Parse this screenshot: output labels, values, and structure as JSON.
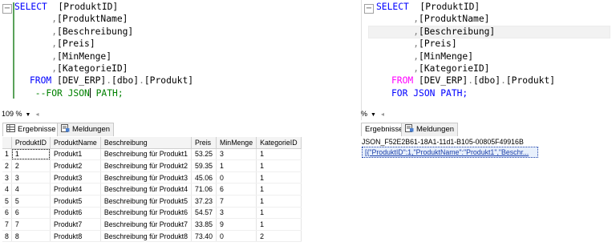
{
  "left_editor": {
    "lines": [
      {
        "parts": [
          {
            "t": "SELECT  ",
            "c": "kw"
          },
          {
            "t": "[ProduktID]",
            "c": "tx"
          }
        ],
        "collapse": "⊟"
      },
      {
        "parts": [
          {
            "t": "      ,",
            "c": "gr"
          },
          {
            "t": "[ProduktName]",
            "c": "tx"
          }
        ]
      },
      {
        "parts": [
          {
            "t": "      ,",
            "c": "gr"
          },
          {
            "t": "[Beschreibung]",
            "c": "tx"
          }
        ]
      },
      {
        "parts": [
          {
            "t": "      ,",
            "c": "gr"
          },
          {
            "t": "[Preis]",
            "c": "tx"
          }
        ]
      },
      {
        "parts": [
          {
            "t": "      ,",
            "c": "gr"
          },
          {
            "t": "[MinMenge]",
            "c": "tx"
          }
        ]
      },
      {
        "parts": [
          {
            "t": "      ,",
            "c": "gr"
          },
          {
            "t": "[KategorieID]",
            "c": "tx"
          }
        ]
      },
      {
        "parts": [
          {
            "t": "  FROM ",
            "c": "kw"
          },
          {
            "t": "[DEV_ERP]",
            "c": "tx"
          },
          {
            "t": ".",
            "c": "gr"
          },
          {
            "t": "[dbo]",
            "c": "tx"
          },
          {
            "t": ".",
            "c": "gr"
          },
          {
            "t": "[Produkt]",
            "c": "tx"
          }
        ]
      },
      {
        "parts": [
          {
            "t": "   --FOR JSON",
            "c": "cm"
          },
          {
            "t": "|",
            "c": "cursor"
          },
          {
            "t": " PATH;",
            "c": "cm"
          }
        ]
      }
    ],
    "zoom": "109 %"
  },
  "right_editor": {
    "lines": [
      {
        "parts": [
          {
            "t": "SELECT  ",
            "c": "kw"
          },
          {
            "t": "[ProduktID]",
            "c": "tx"
          }
        ],
        "collapse": "⊟"
      },
      {
        "parts": [
          {
            "t": "      ,",
            "c": "gr"
          },
          {
            "t": "[ProduktName]",
            "c": "tx"
          }
        ]
      },
      {
        "parts": [
          {
            "t": "      ,",
            "c": "gr"
          },
          {
            "t": "[Beschreibung]",
            "c": "tx"
          }
        ]
      },
      {
        "parts": [
          {
            "t": "      ,",
            "c": "gr"
          },
          {
            "t": "[Preis]",
            "c": "tx"
          }
        ]
      },
      {
        "parts": [
          {
            "t": "      ,",
            "c": "gr"
          },
          {
            "t": "[MinMenge]",
            "c": "tx"
          }
        ]
      },
      {
        "parts": [
          {
            "t": "      ,",
            "c": "gr"
          },
          {
            "t": "[KategorieID]",
            "c": "tx"
          }
        ]
      },
      {
        "parts": [
          {
            "t": "  FROM ",
            "c": "pk"
          },
          {
            "t": "[DEV_ERP]",
            "c": "tx"
          },
          {
            "t": ".",
            "c": "gr"
          },
          {
            "t": "[dbo]",
            "c": "tx"
          },
          {
            "t": ".",
            "c": "gr"
          },
          {
            "t": "[Produkt]",
            "c": "tx"
          }
        ]
      },
      {
        "parts": [
          {
            "t": "  FOR JSON PATH;",
            "c": "kw"
          }
        ]
      }
    ],
    "zoom": "%"
  },
  "left_tabs": {
    "results": "Ergebnisse",
    "messages": "Meldungen"
  },
  "right_tabs": {
    "results": "Ergebnisse",
    "messages": "Meldungen"
  },
  "results": {
    "columns": [
      "ProduktID",
      "ProduktName",
      "Beschreibung",
      "Preis",
      "MinMenge",
      "KategorieID"
    ],
    "rows": [
      [
        "1",
        "1",
        "Produkt1",
        "Beschreibung für Produkt1",
        "53.25",
        "3",
        "1"
      ],
      [
        "2",
        "2",
        "Produkt2",
        "Beschreibung für Produkt2",
        "59.35",
        "1",
        "1"
      ],
      [
        "3",
        "3",
        "Produkt3",
        "Beschreibung für Produkt3",
        "45.06",
        "0",
        "1"
      ],
      [
        "4",
        "4",
        "Produkt4",
        "Beschreibung für Produkt4",
        "71.06",
        "6",
        "1"
      ],
      [
        "5",
        "5",
        "Produkt5",
        "Beschreibung für Produkt5",
        "37.23",
        "7",
        "1"
      ],
      [
        "6",
        "6",
        "Produkt6",
        "Beschreibung für Produkt6",
        "54.57",
        "3",
        "1"
      ],
      [
        "7",
        "7",
        "Produkt7",
        "Beschreibung für Produkt7",
        "33.85",
        "9",
        "1"
      ],
      [
        "8",
        "8",
        "Produkt8",
        "Beschreibung für Produkt8",
        "73.40",
        "0",
        "2"
      ]
    ]
  },
  "json_result": {
    "header": "JSON_F52E2B61-18A1-11d1-B105-00805F49916B",
    "value": "[{\"ProduktID\":1,\"ProduktName\":\"Produkt1\",\"Beschr..."
  }
}
